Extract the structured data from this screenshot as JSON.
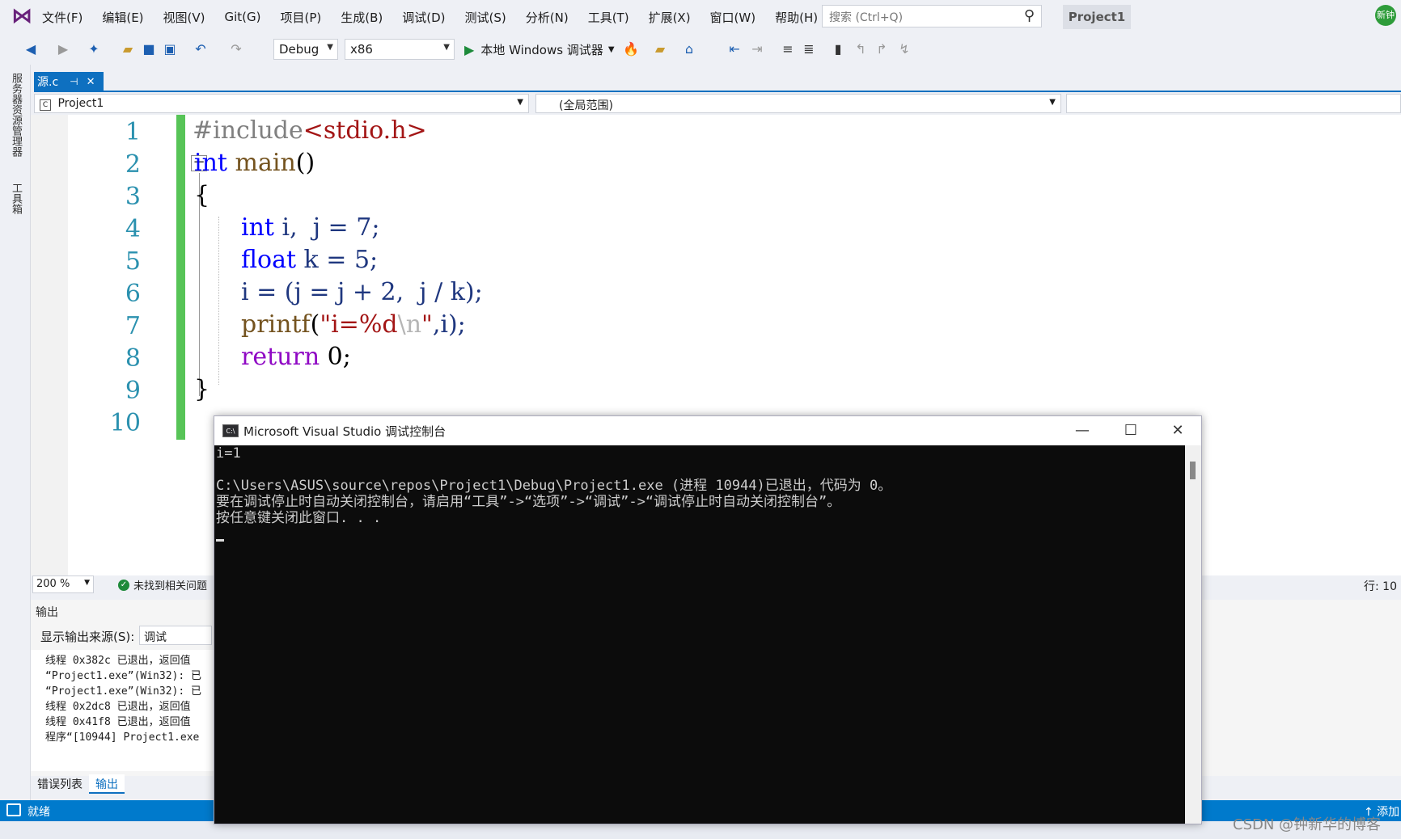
{
  "menu": {
    "items": [
      "文件(F)",
      "编辑(E)",
      "视图(V)",
      "Git(G)",
      "项目(P)",
      "生成(B)",
      "调试(D)",
      "测试(S)",
      "分析(N)",
      "工具(T)",
      "扩展(X)",
      "窗口(W)",
      "帮助(H)"
    ],
    "search_placeholder": "搜索 (Ctrl+Q)",
    "project_title": "Project1",
    "avatar_text": "新钟"
  },
  "toolbar": {
    "config": "Debug",
    "platform": "x86",
    "run_label": "本地 Windows 调试器"
  },
  "left_strip": {
    "tab1": "服务器资源管理器",
    "tab2": "工具箱"
  },
  "doc_tab": {
    "label": "源.c",
    "pin": "⊣",
    "close": "✕"
  },
  "nav": {
    "project": "Project1",
    "scope": "(全局范围)"
  },
  "editor": {
    "line_numbers": [
      "1",
      "2",
      "3",
      "4",
      "5",
      "6",
      "7",
      "8",
      "9",
      "10"
    ],
    "lines": {
      "l1_pp": "#include",
      "l1_inc": "<stdio.h>",
      "l2_kw": "int",
      "l2_fn": " main",
      "l2_rest": "()",
      "l3": "{",
      "l4_kw": "int",
      "l4_rest": " i,  j = 7;",
      "l5_kw": "float",
      "l5_rest": " k = 5;",
      "l6": "i = (j = j + 2,  j / k);",
      "l7_fn": "printf",
      "l7_open": "(",
      "l7_str": "\"i=%d",
      "l7_esc": "\\n",
      "l7_str2": "\"",
      "l7_close": ",i);",
      "l8_kw": "return",
      "l8_rest": " 0;",
      "l9": "}"
    },
    "zoom": "200 %",
    "issues": "未找到相关问题",
    "row": "行: 10"
  },
  "output": {
    "title": "输出",
    "source_label": "显示输出来源(S):",
    "source_value": "调试",
    "lines": [
      "线程 0x382c 已退出，返回值",
      "“Project1.exe”(Win32): 已",
      "“Project1.exe”(Win32): 已",
      "线程 0x2dc8 已退出，返回值",
      "线程 0x41f8 已退出，返回值",
      "程序“[10944] Project1.exe"
    ],
    "tabs": [
      "错误列表",
      "输出"
    ]
  },
  "status": {
    "text": "就绪",
    "add": "↑ 添加"
  },
  "console": {
    "icon_text": "C:\\",
    "title": "Microsoft Visual Studio 调试控制台",
    "minimize": "—",
    "maximize": "☐",
    "close": "✕",
    "lines": [
      "i=1",
      "",
      "C:\\Users\\ASUS\\source\\repos\\Project1\\Debug\\Project1.exe (进程 10944)已退出，代码为 0。",
      "要在调试停止时自动关闭控制台，请启用“工具”->“选项”->“调试”->“调试停止时自动关闭控制台”。",
      "按任意键关闭此窗口. . ."
    ]
  },
  "watermark": "CSDN @钟新华的博客"
}
